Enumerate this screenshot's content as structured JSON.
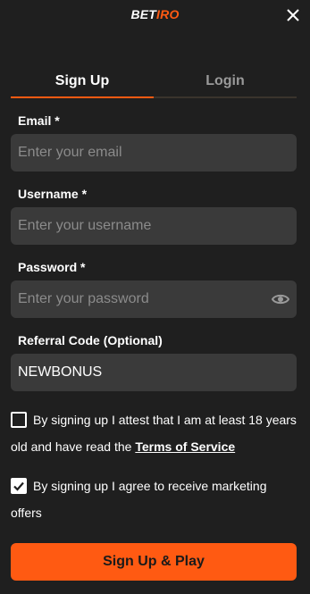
{
  "header": {
    "logo_part1": "BET",
    "logo_part2": "IRO",
    "close_icon": "close-icon"
  },
  "tabs": {
    "signup_label": "Sign Up",
    "login_label": "Login",
    "active": "Sign Up"
  },
  "form": {
    "email_label": "Email *",
    "email_placeholder": "Enter your email",
    "username_label": "Username *",
    "username_placeholder": "Enter your username",
    "password_label": "Password *",
    "password_placeholder": "Enter your password",
    "password_icon": "eye-icon",
    "referral_label": "Referral Code (Optional)",
    "referral_value": "NEWBONUS"
  },
  "consents": {
    "age_text": "By signing up I attest that I am at least 18 years old and have read the ",
    "age_link": "Terms of Service",
    "age_checked": false,
    "marketing_text": "By signing up I agree to receive marketing offers",
    "marketing_checked": true
  },
  "cta": {
    "label": "Sign Up & Play"
  },
  "colors": {
    "accent": "#ff5a12",
    "background": "#1f1f1f",
    "field": "#3a3a3a"
  }
}
